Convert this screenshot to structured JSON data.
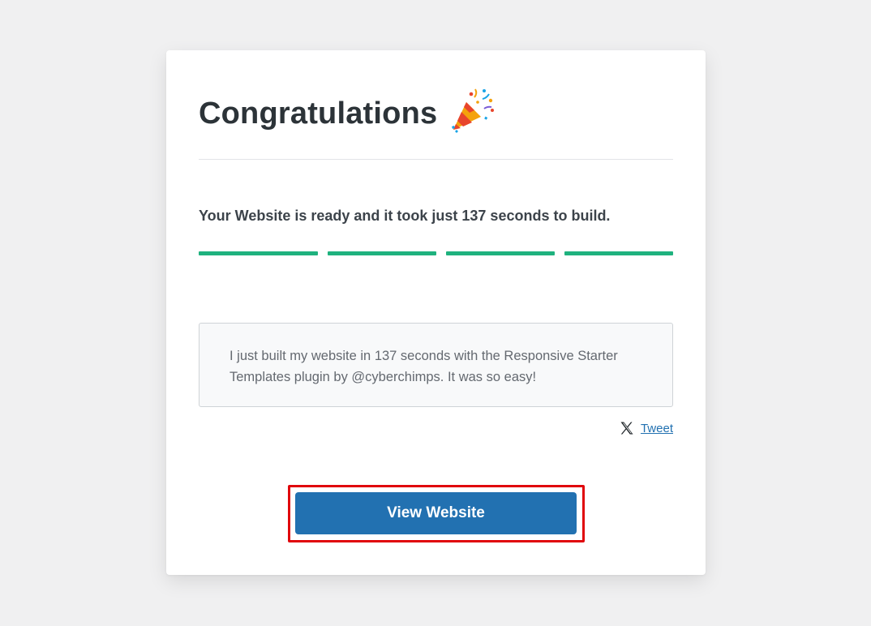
{
  "header": {
    "title": "Congratulations",
    "icon": "party-popper-icon"
  },
  "status": {
    "message": "Your Website is ready and it took just 137 seconds to build.",
    "progress_steps_completed": 4,
    "progress_steps_total": 4,
    "progress_color": "#1fb27e"
  },
  "share": {
    "tweet_text": "I just built my website in 137 seconds with the Responsive Starter Templates plugin by @cyberchimps. It was so easy!",
    "tweet_label": "Tweet",
    "tweet_icon": "x-logo-icon"
  },
  "actions": {
    "view_website_label": "View Website",
    "button_color": "#2271b1",
    "highlight_color": "#e0060c"
  }
}
